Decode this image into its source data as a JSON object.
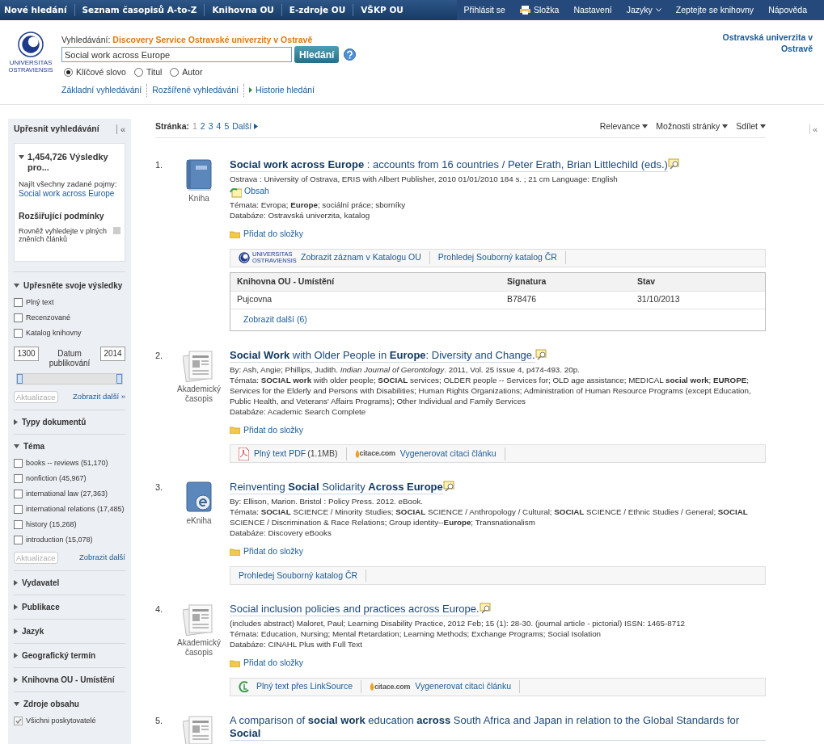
{
  "top_nav": {
    "left": [
      "Nové hledání",
      "Seznam časopisů A-to-Z",
      "Knihovna OU",
      "E-zdroje OU",
      "VŠKP OU"
    ],
    "right": [
      {
        "label": "Přihlásit se",
        "kind": "plain"
      },
      {
        "label": "Složka",
        "kind": "folder"
      },
      {
        "label": "Nastavení",
        "kind": "plain"
      },
      {
        "label": "Jazyky",
        "kind": "menu"
      },
      {
        "label": "Zeptejte se knihovny",
        "kind": "plain"
      },
      {
        "label": "Nápověda",
        "kind": "plain"
      }
    ]
  },
  "header": {
    "logo_text": [
      "UNIVERSITAS",
      "OSTRAVIENSIS"
    ],
    "search_label": "Vyhledávání:",
    "search_source": "Discovery Service Ostravské univerzity v Ostravě",
    "query": "Social work across Europe",
    "search_button": "Hledání",
    "modes": [
      {
        "label": "Klíčové slovo",
        "selected": true
      },
      {
        "label": "Titul",
        "selected": false
      },
      {
        "label": "Autor",
        "selected": false
      }
    ],
    "links": [
      {
        "label": "Základní vyhledávání",
        "kind": "plain"
      },
      {
        "label": "Rozšířené vyhledávání",
        "kind": "plain"
      },
      {
        "label": "Historie hledání",
        "kind": "history"
      }
    ],
    "institution": "Ostravská univerzita v Ostravě"
  },
  "sidebar": {
    "title": "Upřesnit vyhledávání",
    "collapse": "«",
    "summary": {
      "count": "1,454,726 Výsledky pro...",
      "find_label": "Najít všechny zadané pojmy:",
      "query": "Social work across Europe",
      "expanders_title": "Rozšiřující podmínky",
      "expander": "Rovněž vyhledejte v plných zněních článků"
    },
    "facets": [
      {
        "title": "Upřesněte svoje výsledky",
        "expanded": true,
        "options": [
          {
            "label": "Plný text",
            "checked": false
          },
          {
            "label": "Recenzované",
            "checked": false
          },
          {
            "label": "Katalog knihovny",
            "checked": false
          }
        ],
        "date": {
          "from": "1300",
          "to": "2014",
          "label": "Datum publikování",
          "level": 1
        },
        "update": "Aktualizace",
        "more": "Zobrazit další »"
      },
      {
        "title": "Typy dokumentů",
        "expanded": false
      },
      {
        "title": "Téma",
        "expanded": true,
        "options": [
          {
            "label": "books -- reviews (51,170)",
            "checked": false
          },
          {
            "label": "nonfiction (45,967)",
            "checked": false
          },
          {
            "label": "international law (27,363)",
            "checked": false
          },
          {
            "label": "international relations (17,485)",
            "checked": false
          },
          {
            "label": "history (15,268)",
            "checked": false
          },
          {
            "label": "introduction (15,078)",
            "checked": false
          }
        ],
        "update": "Aktualizace",
        "more": "Zobrazit další"
      },
      {
        "title": "Vydavatel",
        "expanded": false
      },
      {
        "title": "Publikace",
        "expanded": false
      },
      {
        "title": "Jazyk",
        "expanded": false
      },
      {
        "title": "Geografický termín",
        "expanded": false
      },
      {
        "title": "Knihovna OU - Umístění",
        "expanded": false
      },
      {
        "title": "Zdroje obsahu",
        "expanded": true,
        "options": [
          {
            "label": "Všichni poskytovatelé",
            "checked": true
          }
        ]
      }
    ]
  },
  "results_toolbar": {
    "page_label": "Stránka:",
    "pages": [
      {
        "label": "1",
        "selected": true
      },
      {
        "label": "2",
        "selected": false
      },
      {
        "label": "3",
        "selected": false
      },
      {
        "label": "4",
        "selected": false
      },
      {
        "label": "5",
        "selected": false
      }
    ],
    "next": "Další",
    "menus": [
      "Relevance",
      "Možnosti stránky",
      "Sdílet"
    ]
  },
  "right_collapse": "«",
  "results": [
    {
      "number": "1.",
      "kind": "book",
      "type_label": "Kniha",
      "title": "**Social work across Europe** : accounts from 16 countries / Peter Erath, Brian Littlechild (eds.)",
      "lines": [
        "Ostrava : University of Ostrava, ERIS with Albert Publisher, 2010 01/01/2010 184 s. ; 21 cm Language: English"
      ],
      "contents_link": "Obsah",
      "lines_after": [
        "Témata: Evropa; **Europe**; sociální práce; sborníky",
        "Databáze: Ostravská univerzita, katalog"
      ],
      "folder_link": "Přidat do složky",
      "links": [
        {
          "kind": "university",
          "logo_text": "UNIVERSITAS OSTRAVIENSIS",
          "label": "Zobrazit záznam v Katalogu OU"
        },
        {
          "kind": "plain",
          "label": "Prohledej Souborný katalog ČR"
        }
      ],
      "holdings": {
        "columns": [
          "Knihovna OU - Umístění",
          "Signatura",
          "Stav"
        ],
        "rows": [
          [
            "Pujcovna",
            "B78476",
            "31/10/2013"
          ]
        ],
        "more": "Zobrazit další (6)"
      }
    },
    {
      "number": "2.",
      "kind": "journal",
      "type_label": "Akademický časopis",
      "title": "**Social Work** with Older People in **Europe**: Diversity and Change.",
      "lines": [
        "By: Ash, Angie; Phillips, Judith. *Indian Journal of Gerontology*. 2011, Vol. 25 Issue 4, p474-493. 20p.",
        "Témata: **SOCIAL work** with older people; **SOCIAL** services; OLDER people -- Services for; OLD age assistance; MEDICAL **social work**; **EUROPE**; Services for the Elderly and Persons with Disabilities; Human Rights Organizations; Administration of Human Resource Programs (except Education, Public Health, and Veterans' Affairs Programs); Other Individual and Family Services",
        "Databáze: Academic Search Complete"
      ],
      "folder_link": "Přidat do složky",
      "links": [
        {
          "kind": "pdf",
          "label": "Plný text PDF",
          "note": "(1.1MB)"
        },
        {
          "kind": "citace",
          "logo_text": "citace.com",
          "label": "Vygenerovat citaci článku"
        }
      ]
    },
    {
      "number": "3.",
      "kind": "ebook",
      "type_label": "eKniha",
      "title": "Reinventing **Social** Solidarity **Across Europe**",
      "lines": [
        "By: Ellison, Marion. Bristol : Policy Press. 2012. eBook.",
        "Témata: **SOCIAL** SCIENCE / Minority Studies; **SOCIAL** SCIENCE / Anthropology / Cultural; **SOCIAL** SCIENCE / Ethnic Studies / General; **SOCIAL** SCIENCE / Discrimination & Race Relations; Group identity--**Europe**; Transnationalism",
        "Databáze: Discovery eBooks"
      ],
      "folder_link": "Přidat do složky",
      "links": [
        {
          "kind": "plain",
          "label": "Prohledej Souborný katalog ČR"
        }
      ]
    },
    {
      "number": "4.",
      "kind": "journal",
      "type_label": "Akademický časopis",
      "title": "Social inclusion policies and practices across Europe.",
      "lines": [
        "(includes abstract) Maloret, Paul; Learning Disability Practice, 2012 Feb; 15 (1): 28-30. (journal article - pictorial) ISSN: 1465-8712",
        "Témata: Education, Nursing; Mental Retardation; Learning Methods; Exchange Programs; Social Isolation",
        "Databáze: CINAHL Plus with Full Text"
      ],
      "folder_link": "Přidat do složky",
      "links": [
        {
          "kind": "linksource",
          "label": "Plný text přes LinkSource"
        },
        {
          "kind": "citace",
          "logo_text": "citace.com",
          "label": "Vygenerovat citaci článku"
        }
      ]
    },
    {
      "number": "5.",
      "kind": "journal",
      "title": "A comparison of **social work** education **across** South Africa and Japan in relation to the Global Standards for **Social**"
    }
  ]
}
